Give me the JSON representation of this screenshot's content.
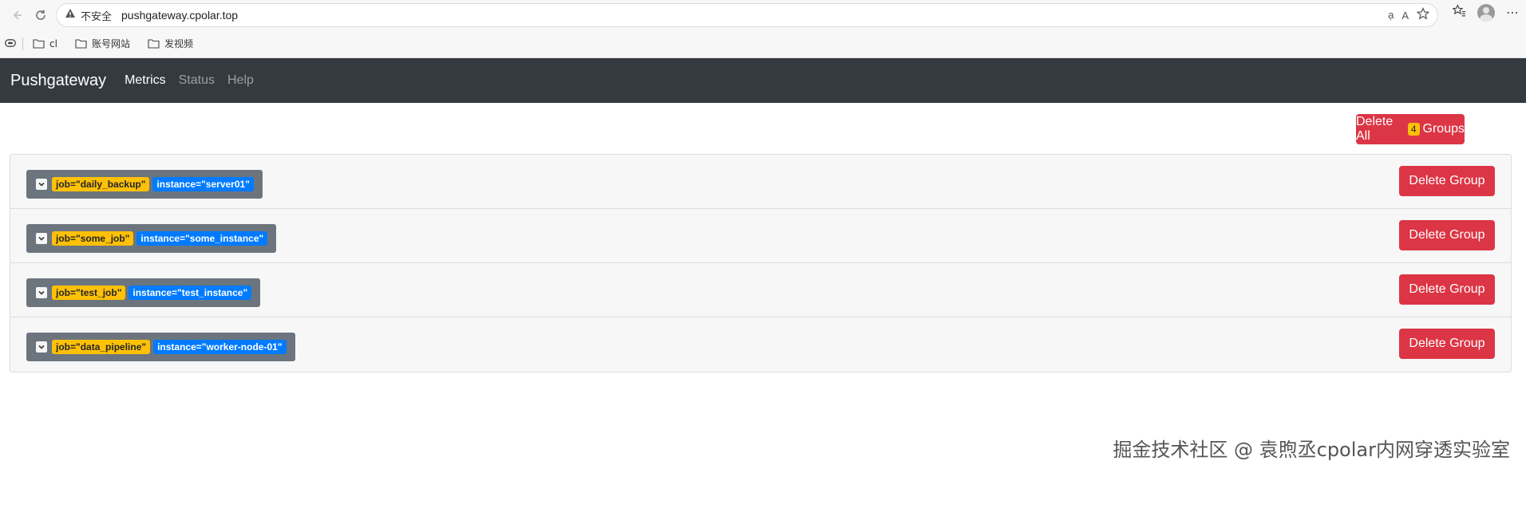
{
  "browser": {
    "security_warning": "不安全",
    "url": "pushgateway.cpolar.top",
    "bookmarks": [
      {
        "label": "cl"
      },
      {
        "label": "账号网站"
      },
      {
        "label": "发视频"
      }
    ]
  },
  "navbar": {
    "brand": "Pushgateway",
    "links": [
      {
        "label": "Metrics",
        "active": true
      },
      {
        "label": "Status",
        "active": false
      },
      {
        "label": "Help",
        "active": false
      }
    ]
  },
  "toolbar": {
    "delete_all_prefix": "Delete All",
    "group_count": "4",
    "delete_all_suffix": "Groups"
  },
  "groups": [
    {
      "job": "job=\"daily_backup\"",
      "instance": "instance=\"server01\"",
      "delete_label": "Delete Group"
    },
    {
      "job": "job=\"some_job\"",
      "instance": "instance=\"some_instance\"",
      "delete_label": "Delete Group"
    },
    {
      "job": "job=\"test_job\"",
      "instance": "instance=\"test_instance\"",
      "delete_label": "Delete Group"
    },
    {
      "job": "job=\"data_pipeline\"",
      "instance": "instance=\"worker-node-01\"",
      "delete_label": "Delete Group"
    }
  ],
  "watermark": "掘金技术社区 @ 袁煦丞cpolar内网穿透实验室",
  "colors": {
    "navbar_bg": "#343a40",
    "danger": "#dc3545",
    "job_badge": "#ffc107",
    "instance_badge": "#007bff",
    "group_header_bg": "#6c757d"
  }
}
